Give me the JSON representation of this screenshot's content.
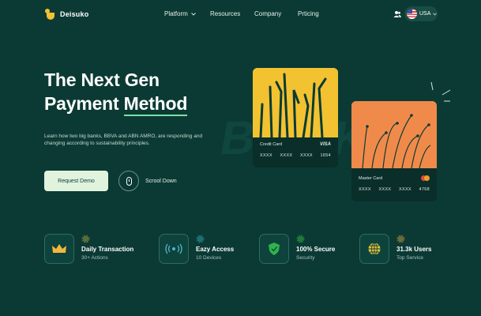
{
  "brand": {
    "name": "Deisuko"
  },
  "nav": {
    "platform": "Platform",
    "resources": "Resources",
    "company": "Company",
    "pricing": "Prticing",
    "language": "USA"
  },
  "hero": {
    "title_line1": "The Next Gen",
    "title_line2_part1": "Payment ",
    "title_line2_part2": "Method",
    "description": "Learn how two big banks, BBVA and ABN AMRO, are responding and changing according to sustainability principles.",
    "cta_primary": "Request Demo",
    "cta_secondary": "Scrool Down",
    "watermark": "BANK"
  },
  "cards": [
    {
      "label": "Credit Card",
      "brand": "VISA",
      "number": [
        "XXXX",
        "XXXX",
        "XXXX",
        "1654"
      ]
    },
    {
      "label": "Master Card",
      "brand": "mastercard-logo",
      "number": [
        "XXXX",
        "XXXX",
        "XXXX",
        "4768"
      ]
    }
  ],
  "stats": [
    {
      "title": "Daily Transaction",
      "subtitle": "30+ Actions",
      "icon": "crown-icon"
    },
    {
      "title": "Eazy Access",
      "subtitle": "10 Devices",
      "icon": "wireless-icon"
    },
    {
      "title": "100% Secure",
      "subtitle": "Security",
      "icon": "shield-icon"
    },
    {
      "title": "31.3k Users",
      "subtitle": "Top Service",
      "icon": "globe-icon"
    }
  ],
  "colors": {
    "background": "#0b3a34",
    "accent": "#7be0a6",
    "yellow": "#f2c230",
    "orange": "#f08a4b"
  }
}
